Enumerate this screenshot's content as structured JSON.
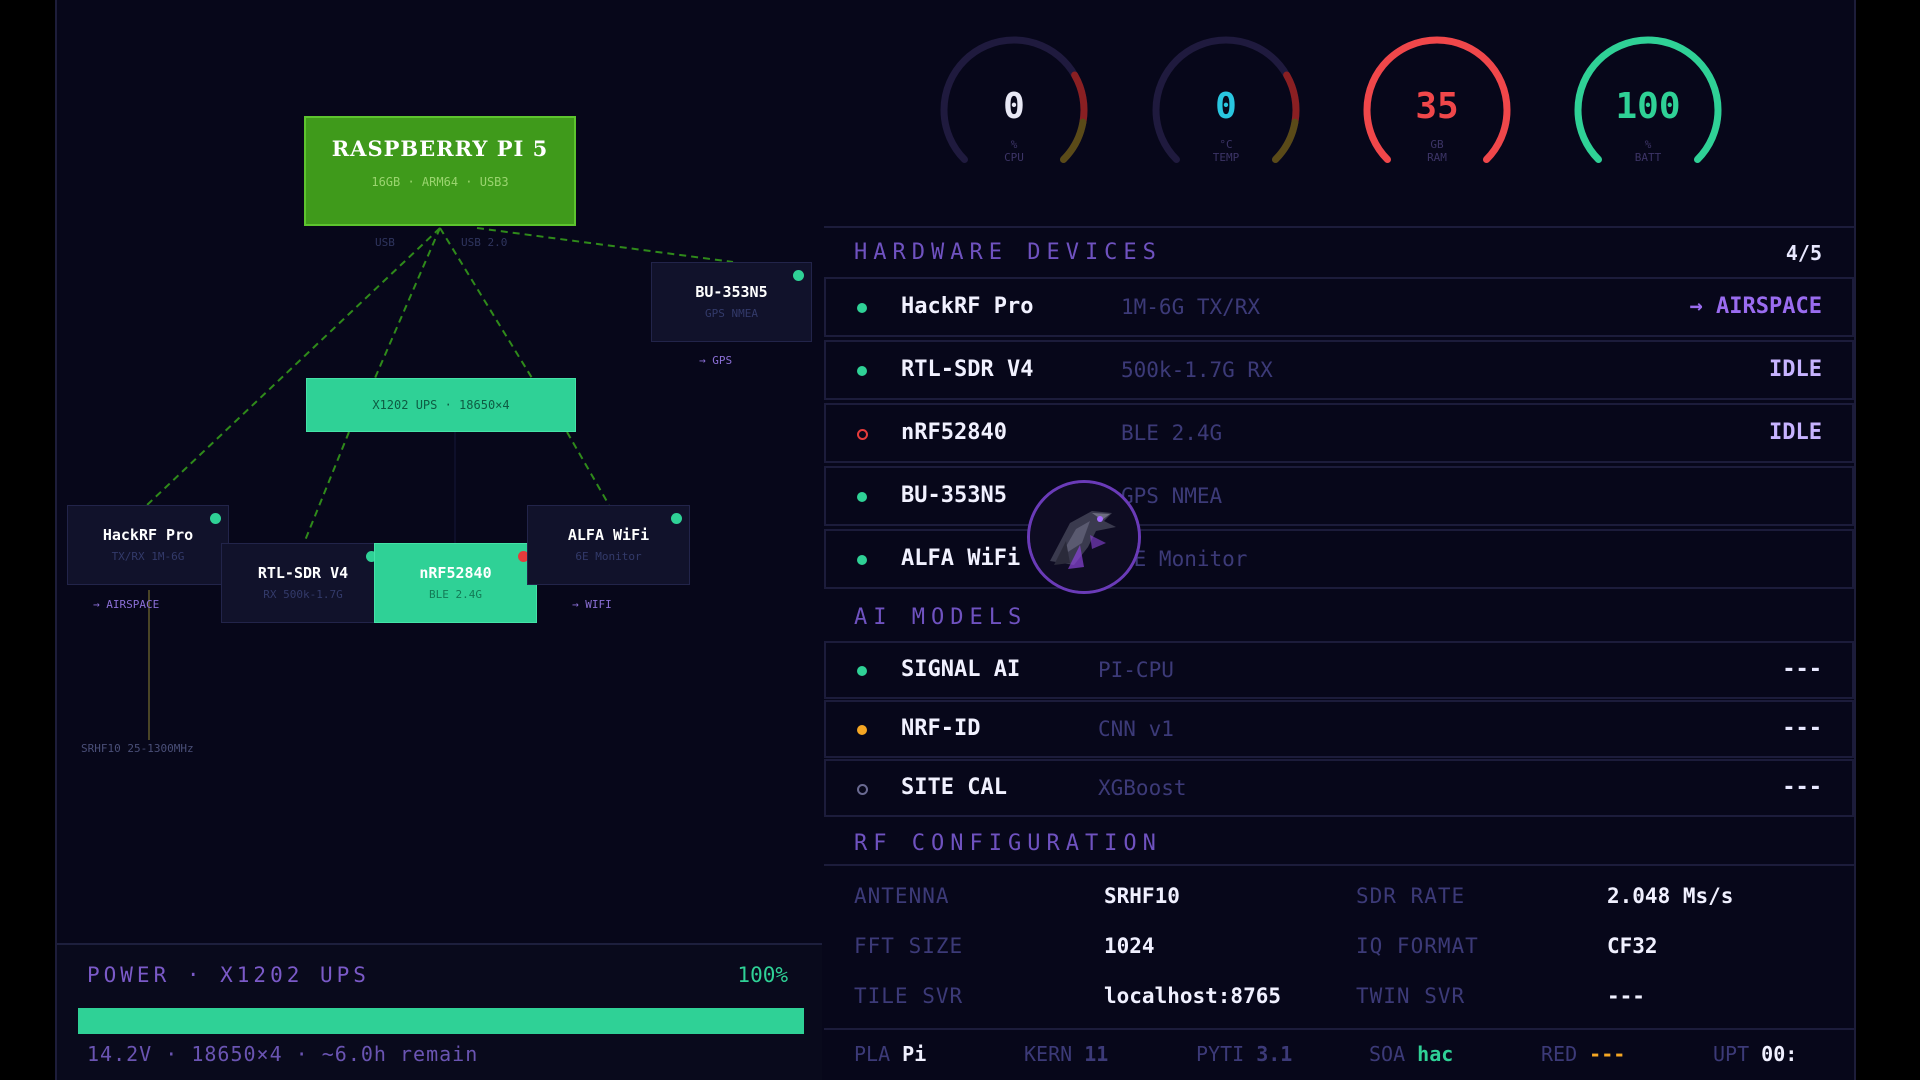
{
  "topology": {
    "pi": {
      "title": "RASPBERRY PI 5",
      "sub": "16GB · ARM64 · USB3"
    },
    "usb_labels": [
      "USB",
      "USB 2.0"
    ],
    "ups": {
      "title": "X1202 UPS · 18650×4"
    },
    "devices": [
      {
        "title": "HackRF Pro",
        "sub": "TX/RX 1M-6G",
        "link": "→ AIRSPACE",
        "dot": "#2fd196"
      },
      {
        "title": "RTL-SDR V4",
        "sub": "RX 500k-1.7G",
        "link": "",
        "dot": "#2fd196"
      },
      {
        "title": "nRF52840",
        "sub": "BLE 2.4G",
        "link": "",
        "dot": "#e53b3b"
      },
      {
        "title": "ALFA WiFi",
        "sub": "6E Monitor",
        "link": "→ WIFI",
        "dot": "#2fd196"
      },
      {
        "title": "BU-353N5",
        "sub": "GPS NMEA",
        "link": "→ GPS",
        "dot": "#2fd196"
      }
    ],
    "antenna_label": "SRHF10 25-1300MHz"
  },
  "power": {
    "title": "POWER · X1202 UPS",
    "percent_label": "100%",
    "percent": 100,
    "info": "14.2V · 18650×4 · ~6.0h remain"
  },
  "gauges": [
    {
      "value": "0",
      "unit": "%",
      "label": "CPU",
      "level": 0,
      "color": "#e8e8f5"
    },
    {
      "value": "0",
      "unit": "°C",
      "label": "TEMP",
      "level": 0,
      "color": "#29c6e0"
    },
    {
      "value": "35",
      "unit": "GB",
      "label": "RAM",
      "level": 1,
      "color": "#f0474a"
    },
    {
      "value": "100",
      "unit": "%",
      "label": "BATT",
      "level": 1,
      "color": "#2fd196"
    }
  ],
  "hardware": {
    "title": "HARDWARE DEVICES",
    "count": "4/5",
    "rows": [
      {
        "name": "HackRF Pro",
        "spec": "1M-6G TX/RX",
        "status": "→ AIRSPACE",
        "status_color": "#9a6cf0",
        "dot": "#2fd196",
        "hollow": false
      },
      {
        "name": "RTL-SDR V4",
        "spec": "500k-1.7G RX",
        "status": "IDLE",
        "status_color": "#c7b3ff",
        "dot": "#2fd196",
        "hollow": false
      },
      {
        "name": "nRF52840",
        "spec": "BLE 2.4G",
        "status": "IDLE",
        "status_color": "#c7b3ff",
        "dot": "#e53b3b",
        "hollow": true
      },
      {
        "name": "BU-353N5",
        "spec": "GPS NMEA",
        "status": "",
        "status_color": "#c7b3ff",
        "dot": "#2fd196",
        "hollow": false
      },
      {
        "name": "ALFA WiFi",
        "spec": "6E Monitor",
        "status": "",
        "status_color": "#c7b3ff",
        "dot": "#2fd196",
        "hollow": false
      }
    ]
  },
  "ai": {
    "title": "AI MODELS",
    "rows": [
      {
        "name": "SIGNAL AI",
        "spec": "PI-CPU",
        "status": "---",
        "dot": "#2fd196",
        "hollow": false
      },
      {
        "name": "NRF-ID",
        "spec": "CNN v1",
        "status": "---",
        "dot": "#f5a623",
        "hollow": false
      },
      {
        "name": "SITE CAL",
        "spec": "XGBoost",
        "status": "---",
        "dot": "#6a6a92",
        "hollow": true
      }
    ]
  },
  "rf": {
    "title": "RF CONFIGURATION",
    "items": [
      {
        "key": "ANTENNA",
        "value": "SRHF10"
      },
      {
        "key": "SDR RATE",
        "value": "2.048 Ms/s"
      },
      {
        "key": "FFT SIZE",
        "value": "1024"
      },
      {
        "key": "IQ FORMAT",
        "value": "CF32"
      },
      {
        "key": "TILE SVR",
        "value": "localhost:8765"
      },
      {
        "key": "TWIN SVR",
        "value": "---"
      }
    ]
  },
  "statusbar": [
    {
      "key": "PLA",
      "value": "Pi",
      "color": "#f0f0ff"
    },
    {
      "key": "KERN",
      "value": "11",
      "color": "#3c3a78"
    },
    {
      "key": "PYTI",
      "value": "3.1",
      "color": "#3c3a78"
    },
    {
      "key": "SOA",
      "value": "hac",
      "color": "#2fd196"
    },
    {
      "key": "RED",
      "value": "---",
      "color": "#f5a623"
    },
    {
      "key": "UPT",
      "value": "00:",
      "color": "#f0f0ff"
    }
  ]
}
